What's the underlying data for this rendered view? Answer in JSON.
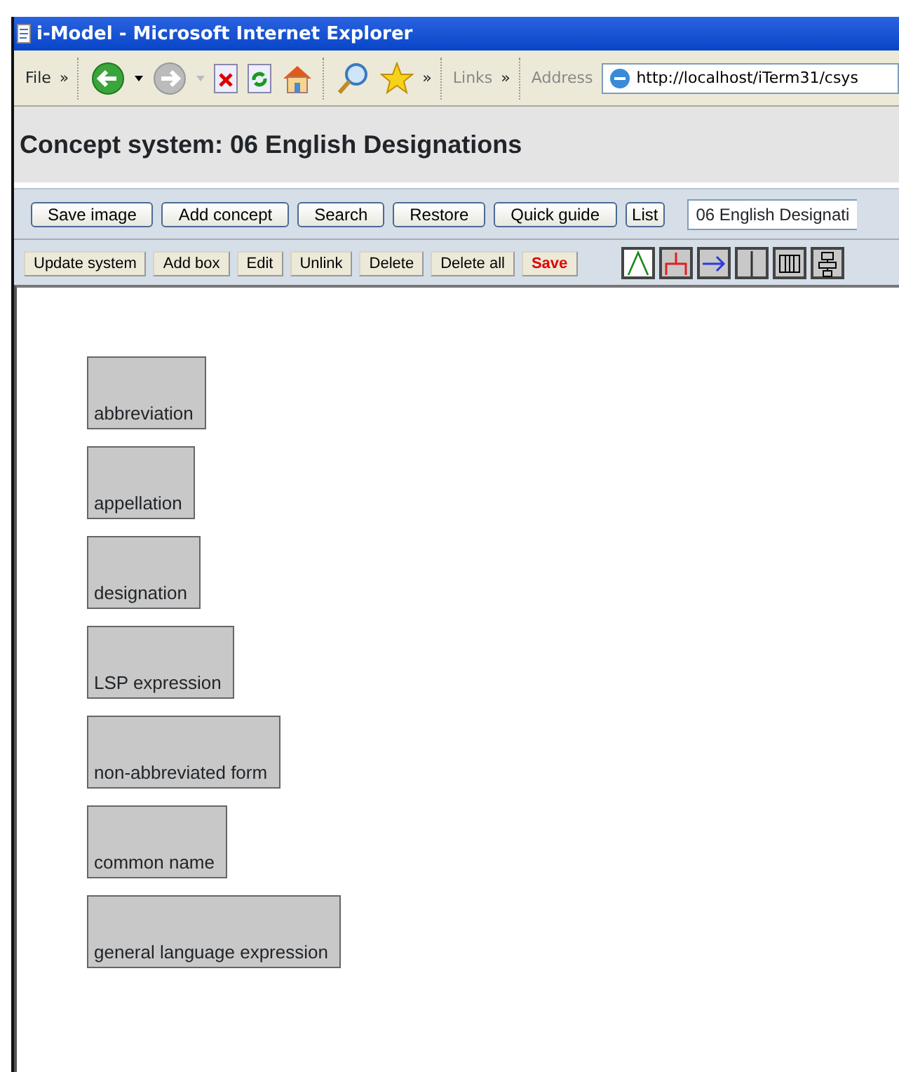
{
  "window": {
    "title": "i-Model - Microsoft Internet Explorer"
  },
  "menu": {
    "label": "File",
    "more": "»"
  },
  "browser_toolbar": {
    "more": "»",
    "links_label": "Links",
    "links_more": "»",
    "address_label": "Address",
    "address": "http://localhost/iTerm31/csys"
  },
  "page_title": "Concept system: 06 English Designations",
  "top_buttons": [
    "Save image",
    "Add concept",
    "Search",
    "Restore",
    "Quick guide",
    "List"
  ],
  "system_select": {
    "value": "06 English Designati"
  },
  "edit_buttons": [
    {
      "label": "Update system",
      "kind": "normal"
    },
    {
      "label": "Add box",
      "kind": "normal"
    },
    {
      "label": "Edit",
      "kind": "normal"
    },
    {
      "label": "Unlink",
      "kind": "normal"
    },
    {
      "label": "Delete",
      "kind": "normal"
    },
    {
      "label": "Delete all",
      "kind": "normal"
    },
    {
      "label": "Save",
      "kind": "warning"
    }
  ],
  "link_tools": [
    {
      "kind": "generic",
      "selected": true
    },
    {
      "kind": "partitive",
      "selected": false
    },
    {
      "kind": "associative",
      "selected": false
    },
    {
      "kind": "vertical",
      "selected": false
    },
    {
      "kind": "columns",
      "selected": false
    },
    {
      "kind": "stack",
      "selected": false
    }
  ],
  "concepts": [
    {
      "label": "abbreviation"
    },
    {
      "label": "appellation"
    },
    {
      "label": "designation"
    },
    {
      "label": "LSP expression"
    },
    {
      "label": "non-abbreviated form"
    },
    {
      "label": "common name"
    },
    {
      "label": "general language expression"
    }
  ]
}
